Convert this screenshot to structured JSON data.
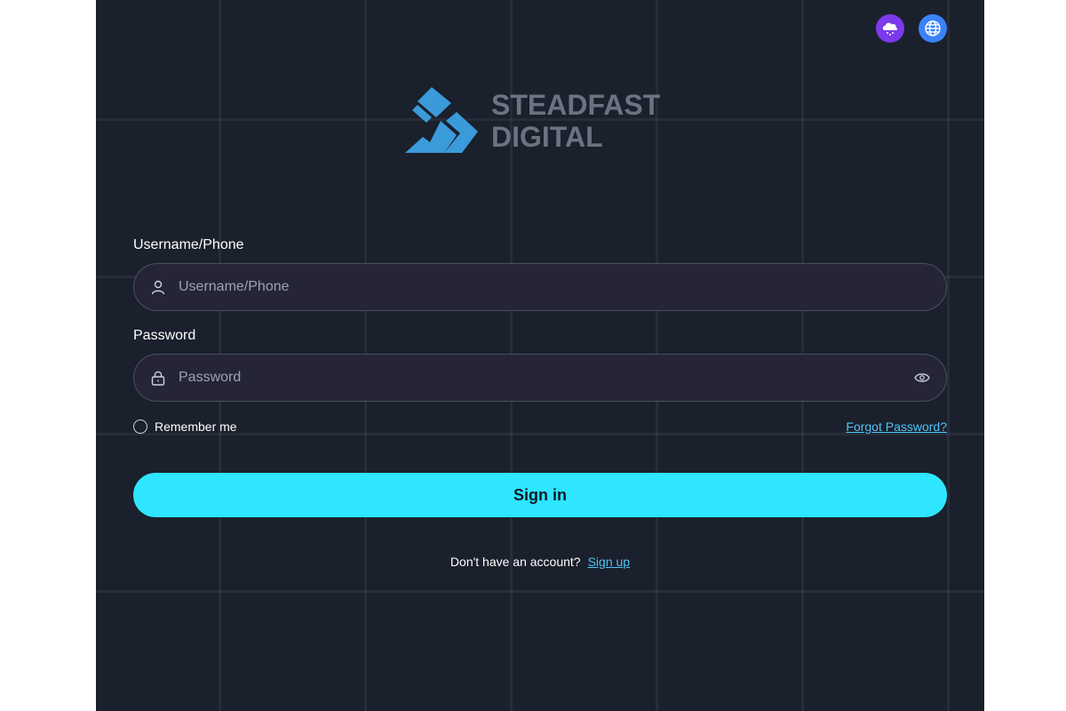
{
  "header": {
    "theme_icon": "cloud-rain-icon",
    "language_icon": "globe-icon"
  },
  "logo": {
    "line1": "STEADFAST",
    "line2": "DIGITAL",
    "mark_color": "#3b9ad9",
    "text_color": "#6b7280"
  },
  "form": {
    "username": {
      "label": "Username/Phone",
      "placeholder": "Username/Phone",
      "value": "",
      "icon": "user-icon"
    },
    "password": {
      "label": "Password",
      "placeholder": "Password",
      "value": "",
      "icon": "lock-icon",
      "toggle_icon": "eye-icon"
    },
    "remember_label": "Remember me",
    "forgot_label": "Forgot Password?",
    "submit_label": "Sign in",
    "signup_prompt": "Don't have an account?",
    "signup_label": "Sign up"
  },
  "colors": {
    "background": "#1a202c",
    "accent": "#2ee6ff",
    "link": "#4fc3f7"
  }
}
